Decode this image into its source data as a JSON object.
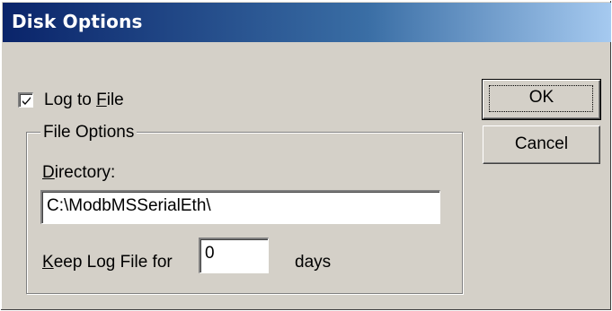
{
  "window": {
    "title": "Disk Options"
  },
  "log_to_file": {
    "label_pre": "Log to ",
    "label_accel": "F",
    "label_post": "ile",
    "checked": true
  },
  "file_options": {
    "group_label": "File Options",
    "directory_label_accel": "D",
    "directory_label_rest": "irectory:",
    "directory_value": "C:\\ModbMSSerialEth\\",
    "keep_label_accel": "K",
    "keep_label_rest": "eep Log File for",
    "keep_value": "0",
    "days_label": "days"
  },
  "buttons": {
    "ok": "OK",
    "cancel": "Cancel"
  }
}
